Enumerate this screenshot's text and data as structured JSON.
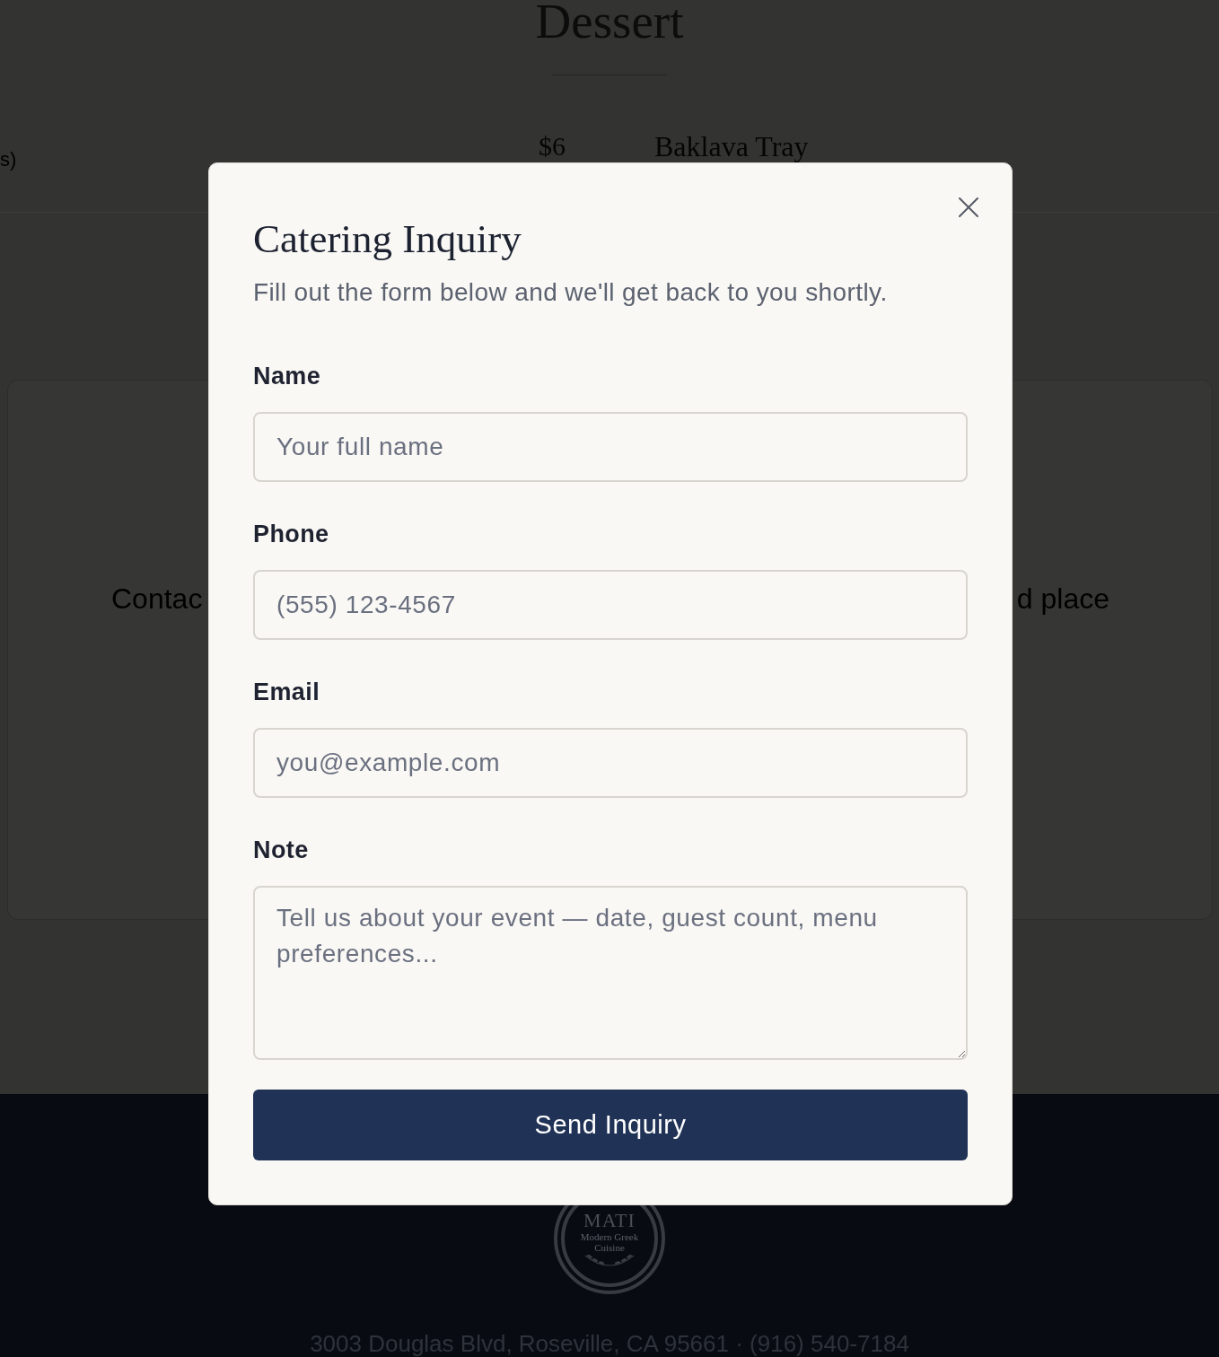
{
  "background_page": {
    "section_heading": "Dessert",
    "menu_row": {
      "column_1": "s)",
      "price": "$6",
      "item": "Baklava Tray"
    },
    "cards": [
      {
        "text": "Contac"
      },
      {
        "text": "d place"
      }
    ]
  },
  "footer": {
    "logo": {
      "wordmark": "MATI",
      "tagline": "Modern Greek Cuisine"
    },
    "address": "3003 Douglas Blvd, Roseville, CA 95661 · (916) 540-7184"
  },
  "dialog": {
    "title": "Catering Inquiry",
    "subtitle": "Fill out the form below and we'll get back to you shortly.",
    "fields": [
      {
        "kind": "input",
        "label": "Name",
        "placeholder": "Your full name"
      },
      {
        "kind": "input",
        "label": "Phone",
        "placeholder": "(555) 123-4567"
      },
      {
        "kind": "input",
        "label": "Email",
        "placeholder": "you@example.com"
      },
      {
        "kind": "textarea",
        "label": "Note",
        "placeholder": "Tell us about your event — date, guest count, menu preferences..."
      }
    ],
    "submit_button": "Send Inquiry"
  }
}
